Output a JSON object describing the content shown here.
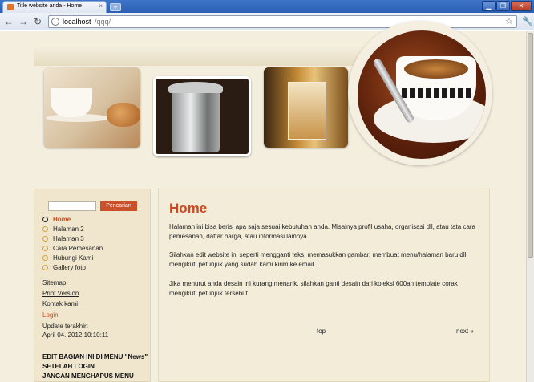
{
  "browser": {
    "tab_title": "Title website anda - Home",
    "tab_close": "×",
    "new_tab": "+",
    "window_buttons": [
      "▁",
      "❐",
      "✕"
    ],
    "nav": {
      "back": "←",
      "forward": "→",
      "reload": "↻"
    },
    "url_host": "localhost",
    "url_path": "/qqq/",
    "star": "☆",
    "wrench": "🔧"
  },
  "sidebar": {
    "search_placeholder": "",
    "search_button": "Pencarian",
    "menu": [
      {
        "label": "Home",
        "active": true
      },
      {
        "label": "Halaman 2"
      },
      {
        "label": "Halaman 3"
      },
      {
        "label": "Cara Pemesanan"
      },
      {
        "label": "Hubungi Kami"
      },
      {
        "label": "Gallery foto"
      }
    ],
    "links": [
      "Sitemap",
      "Print Version",
      "Kontak kami"
    ],
    "login": "Login",
    "update_label": "Update terakhir:",
    "update_date": "April 04. 2012 10:10:11",
    "notes": [
      "EDIT BAGIAN INI DI MENU \"News\"",
      "SETELAH LOGIN",
      "JANGAN MENGHAPUS MENU"
    ]
  },
  "main": {
    "title": "Home",
    "paragraphs": [
      "Halaman ini bisa berisi apa saja sesuai kebutuhan anda. Misalnya profil usaha, organisasi dll, atau tata cara pemesanan, daftar harga, atau informasi lainnya.",
      "Silahkan edit website ini seperti mengganti teks, memasukkan gambar, membuat menu/halaman baru dll mengikuti petunjuk yang sudah kami kirim ke email.",
      "Jika menurut anda desain ini kurang menarik, silahkan ganti desain dari koleksi 600an template corak mengikuti petunjuk tersebut."
    ],
    "top_link": "top",
    "next_link": "next »"
  },
  "colors": {
    "accent": "#c94a20",
    "page_bg": "#f4eede",
    "sidebar_bg": "#efe6cd"
  }
}
